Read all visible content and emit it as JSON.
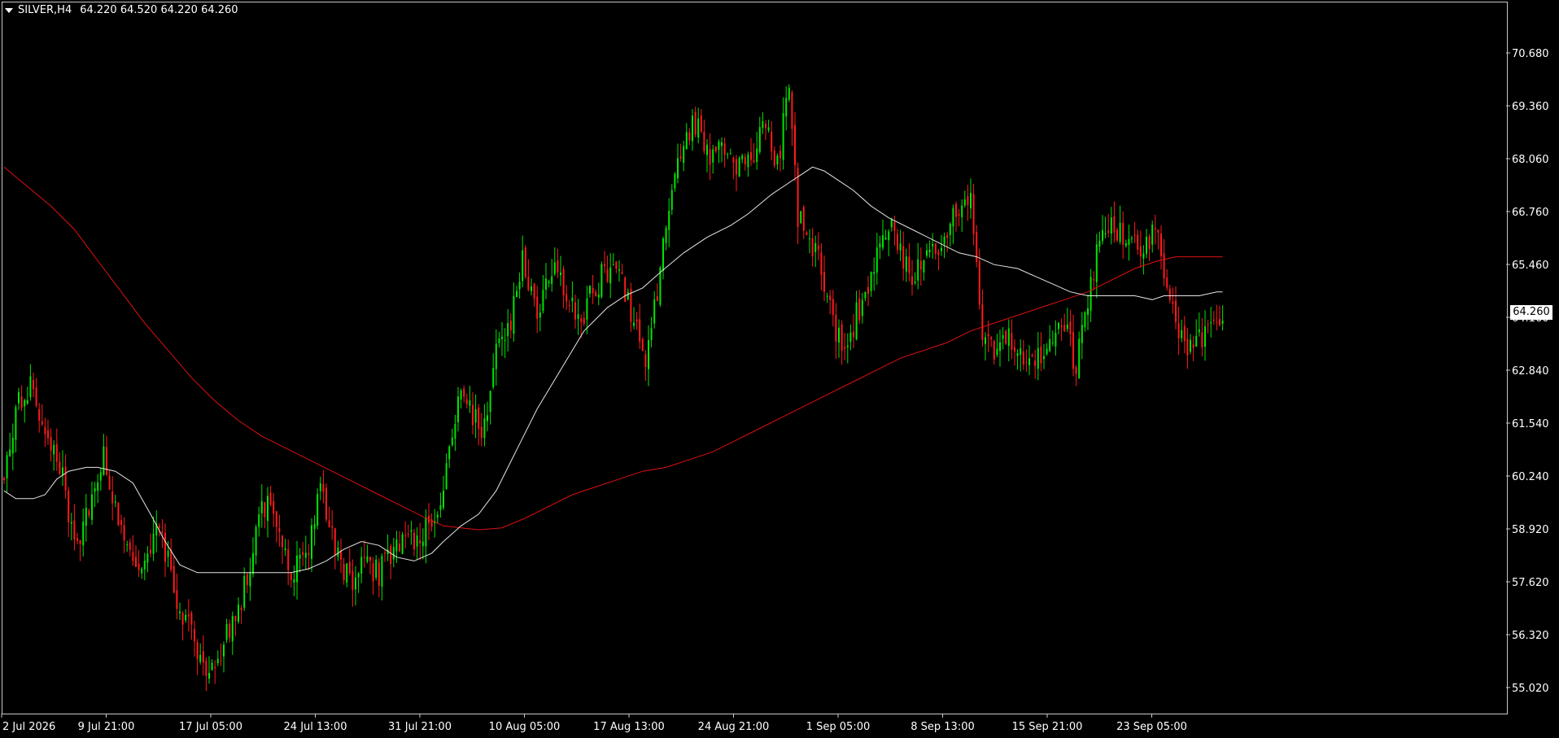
{
  "header": {
    "symbol_tf": "SILVER,H4",
    "ohlc": "64.220 64.520 64.220 64.260"
  },
  "current_price": "64.260",
  "colors": {
    "background": "#000000",
    "bull": "#00e600",
    "bear": "#ff1a1a",
    "ma_fast": "#e6e6e6",
    "ma_slow": "#e01010",
    "axis_text": "#ffffff",
    "frame": "#c8c8c8"
  },
  "chart_data": {
    "type": "candlestick",
    "y_ticks": [
      "70.680",
      "69.360",
      "68.060",
      "66.760",
      "65.460",
      "64.160",
      "62.840",
      "61.540",
      "60.240",
      "58.920",
      "57.620",
      "56.320",
      "55.020"
    ],
    "x_ticks": [
      "2 Jul 2026",
      "9 Jul 21:00",
      "17 Jul 05:00",
      "24 Jul 13:00",
      "31 Jul 21:00",
      "10 Aug 05:00",
      "17 Aug 13:00",
      "24 Aug 21:00",
      "1 Sep 05:00",
      "8 Sep 13:00",
      "15 Sep 21:00",
      "23 Sep 05:00"
    ],
    "ylim": [
      54.5,
      71.9
    ],
    "grid": false,
    "candle_count": 280,
    "close_path": [
      [
        0,
        60.3
      ],
      [
        4,
        62.0
      ],
      [
        9,
        62.5
      ],
      [
        14,
        61.6
      ],
      [
        19,
        60.6
      ],
      [
        24,
        58.6
      ],
      [
        29,
        59.3
      ],
      [
        34,
        60.8
      ],
      [
        38,
        59.4
      ],
      [
        43,
        58.5
      ],
      [
        48,
        57.8
      ],
      [
        53,
        59.0
      ],
      [
        58,
        57.4
      ],
      [
        63,
        56.4
      ],
      [
        68,
        55.4
      ],
      [
        73,
        55.6
      ],
      [
        78,
        56.5
      ],
      [
        83,
        57.6
      ],
      [
        88,
        59.5
      ],
      [
        93,
        59.3
      ],
      [
        98,
        57.8
      ],
      [
        103,
        58.2
      ],
      [
        108,
        59.8
      ],
      [
        113,
        58.6
      ],
      [
        118,
        57.5
      ],
      [
        123,
        58.0
      ],
      [
        128,
        57.8
      ],
      [
        133,
        58.3
      ],
      [
        138,
        58.6
      ],
      [
        143,
        58.8
      ],
      [
        148,
        59.3
      ],
      [
        152,
        60.7
      ],
      [
        155,
        62.5
      ],
      [
        160,
        61.9
      ],
      [
        164,
        61.5
      ],
      [
        168,
        63.8
      ],
      [
        173,
        64.1
      ],
      [
        177,
        66.0
      ],
      [
        182,
        64.2
      ],
      [
        187,
        65.6
      ],
      [
        192,
        64.9
      ],
      [
        196,
        64.1
      ],
      [
        201,
        65.0
      ],
      [
        206,
        65.6
      ],
      [
        211,
        65.2
      ],
      [
        216,
        63.9
      ],
      [
        219,
        62.9
      ],
      [
        222,
        64.5
      ],
      [
        226,
        66.8
      ],
      [
        230,
        68.1
      ],
      [
        235,
        69.5
      ],
      [
        240,
        68.5
      ],
      [
        245,
        68.6
      ],
      [
        250,
        68.1
      ],
      [
        255,
        68.3
      ],
      [
        260,
        69.3
      ],
      [
        264,
        68.2
      ],
      [
        268,
        70.4
      ],
      [
        271,
        66.9
      ],
      [
        275,
        66.5
      ],
      [
        279,
        65.5
      ],
      [
        283,
        64.2
      ],
      [
        287,
        63.5
      ],
      [
        291,
        64.4
      ],
      [
        295,
        65.2
      ],
      [
        299,
        66.2
      ],
      [
        303,
        66.8
      ],
      [
        307,
        65.8
      ],
      [
        311,
        65.4
      ],
      [
        315,
        66.1
      ],
      [
        319,
        66.0
      ],
      [
        323,
        66.6
      ],
      [
        327,
        67.5
      ],
      [
        330,
        67.5
      ],
      [
        334,
        64.1
      ],
      [
        338,
        63.6
      ],
      [
        342,
        63.9
      ],
      [
        346,
        63.3
      ],
      [
        350,
        63.0
      ],
      [
        354,
        63.5
      ],
      [
        358,
        63.8
      ],
      [
        362,
        64.2
      ],
      [
        366,
        63.1
      ],
      [
        369,
        64.6
      ],
      [
        373,
        65.9
      ],
      [
        377,
        66.7
      ],
      [
        381,
        66.5
      ],
      [
        385,
        66.3
      ],
      [
        389,
        65.9
      ],
      [
        393,
        66.8
      ],
      [
        397,
        65.2
      ],
      [
        401,
        64.0
      ],
      [
        405,
        63.6
      ],
      [
        409,
        63.8
      ],
      [
        413,
        64.1
      ],
      [
        416,
        64.26
      ]
    ],
    "ma_fast": [
      [
        0,
        59.9
      ],
      [
        4,
        59.7
      ],
      [
        10,
        59.7
      ],
      [
        14,
        59.8
      ],
      [
        18,
        60.2
      ],
      [
        22,
        60.4
      ],
      [
        28,
        60.5
      ],
      [
        32,
        60.5
      ],
      [
        38,
        60.4
      ],
      [
        44,
        60.1
      ],
      [
        50,
        59.3
      ],
      [
        55,
        58.6
      ],
      [
        60,
        58.0
      ],
      [
        66,
        57.8
      ],
      [
        72,
        57.8
      ],
      [
        78,
        57.8
      ],
      [
        85,
        57.8
      ],
      [
        92,
        57.8
      ],
      [
        98,
        57.8
      ],
      [
        104,
        57.9
      ],
      [
        110,
        58.1
      ],
      [
        116,
        58.4
      ],
      [
        122,
        58.6
      ],
      [
        128,
        58.5
      ],
      [
        134,
        58.2
      ],
      [
        140,
        58.1
      ],
      [
        146,
        58.3
      ],
      [
        150,
        58.6
      ],
      [
        156,
        59.0
      ],
      [
        162,
        59.3
      ],
      [
        168,
        59.9
      ],
      [
        174,
        60.8
      ],
      [
        182,
        62.0
      ],
      [
        190,
        63.0
      ],
      [
        198,
        64.0
      ],
      [
        206,
        64.6
      ],
      [
        212,
        64.9
      ],
      [
        218,
        65.1
      ],
      [
        224,
        65.5
      ],
      [
        232,
        66.0
      ],
      [
        240,
        66.4
      ],
      [
        248,
        66.7
      ],
      [
        254,
        67.0
      ],
      [
        262,
        67.5
      ],
      [
        268,
        67.8
      ],
      [
        272,
        68.0
      ],
      [
        276,
        68.2
      ],
      [
        280,
        68.1
      ],
      [
        284,
        67.9
      ],
      [
        290,
        67.6
      ],
      [
        296,
        67.2
      ],
      [
        302,
        66.9
      ],
      [
        310,
        66.6
      ],
      [
        318,
        66.3
      ],
      [
        326,
        66.0
      ],
      [
        332,
        65.9
      ],
      [
        338,
        65.7
      ],
      [
        346,
        65.6
      ],
      [
        352,
        65.4
      ],
      [
        358,
        65.2
      ],
      [
        364,
        65.0
      ],
      [
        370,
        64.9
      ],
      [
        378,
        64.9
      ],
      [
        386,
        64.9
      ],
      [
        392,
        64.8
      ],
      [
        396,
        64.9
      ],
      [
        402,
        64.9
      ],
      [
        408,
        64.9
      ],
      [
        414,
        65.0
      ],
      [
        416,
        65.0
      ]
    ],
    "ma_slow": [
      [
        0,
        68.2
      ],
      [
        8,
        67.7
      ],
      [
        16,
        67.2
      ],
      [
        24,
        66.6
      ],
      [
        32,
        65.8
      ],
      [
        40,
        65.0
      ],
      [
        48,
        64.2
      ],
      [
        56,
        63.5
      ],
      [
        64,
        62.8
      ],
      [
        72,
        62.2
      ],
      [
        80,
        61.7
      ],
      [
        88,
        61.3
      ],
      [
        96,
        61.0
      ],
      [
        104,
        60.7
      ],
      [
        112,
        60.4
      ],
      [
        120,
        60.1
      ],
      [
        128,
        59.8
      ],
      [
        136,
        59.5
      ],
      [
        144,
        59.2
      ],
      [
        150,
        59.0
      ],
      [
        156,
        58.95
      ],
      [
        162,
        58.9
      ],
      [
        170,
        58.95
      ],
      [
        178,
        59.2
      ],
      [
        186,
        59.5
      ],
      [
        194,
        59.8
      ],
      [
        202,
        60.0
      ],
      [
        210,
        60.2
      ],
      [
        218,
        60.4
      ],
      [
        226,
        60.5
      ],
      [
        234,
        60.7
      ],
      [
        242,
        60.9
      ],
      [
        250,
        61.2
      ],
      [
        258,
        61.5
      ],
      [
        266,
        61.8
      ],
      [
        274,
        62.1
      ],
      [
        282,
        62.4
      ],
      [
        290,
        62.7
      ],
      [
        298,
        63.0
      ],
      [
        306,
        63.3
      ],
      [
        314,
        63.5
      ],
      [
        322,
        63.7
      ],
      [
        330,
        64.0
      ],
      [
        338,
        64.2
      ],
      [
        346,
        64.4
      ],
      [
        354,
        64.6
      ],
      [
        362,
        64.8
      ],
      [
        370,
        65.0
      ],
      [
        378,
        65.3
      ],
      [
        386,
        65.6
      ],
      [
        394,
        65.8
      ],
      [
        400,
        65.9
      ],
      [
        408,
        65.9
      ],
      [
        416,
        65.9
      ]
    ],
    "seed": 20260702
  }
}
